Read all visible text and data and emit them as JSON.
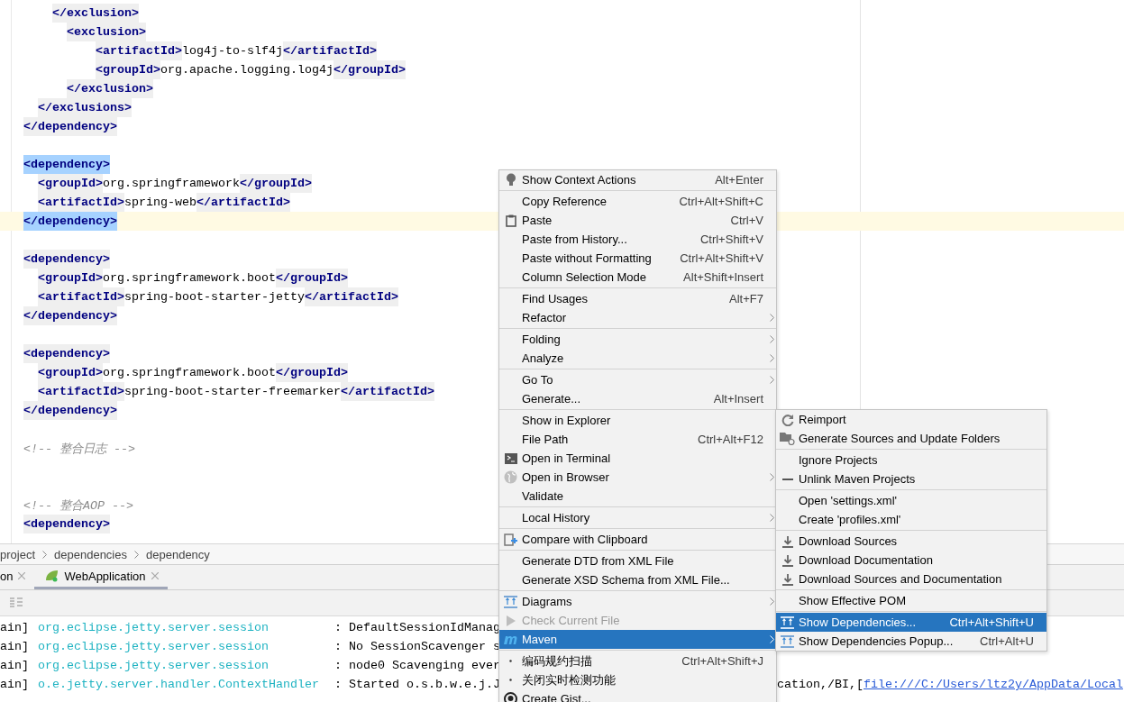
{
  "editor": {
    "lines": [
      {
        "kind": "group",
        "children": [
          {
            "kind": "group",
            "children": [
              {
                "kind": "code",
                "matched": false,
                "current": false,
                "tokens": [
                  {
                    "kind": "tag",
                    "text": "</exclusion>"
                  }
                ]
              },
              {
                "kind": "group",
                "children": [
                  {
                    "kind": "code",
                    "matched": false,
                    "current": false,
                    "tokens": [
                      {
                        "kind": "tag",
                        "text": "<exclusion>"
                      }
                    ],
                    "children": [
                      {
                        "kind": "code",
                        "matched": false,
                        "current": false,
                        "tokens": [
                          {
                            "kind": "tag",
                            "text": "<artifactId>"
                          },
                          {
                            "kind": "text",
                            "text": "log4j-to-slf4j"
                          },
                          {
                            "kind": "tag",
                            "text": "</artifactId>"
                          }
                        ]
                      },
                      {
                        "kind": "code",
                        "matched": false,
                        "current": false,
                        "tokens": [
                          {
                            "kind": "tag",
                            "text": "<groupId>"
                          },
                          {
                            "kind": "text",
                            "text": "org.apache.logging.log4j"
                          },
                          {
                            "kind": "tag",
                            "text": "</groupId>"
                          }
                        ]
                      }
                    ]
                  },
                  {
                    "kind": "code",
                    "matched": false,
                    "current": false,
                    "tokens": [
                      {
                        "kind": "tag",
                        "text": "</exclusion>"
                      }
                    ]
                  }
                ]
              }
            ]
          },
          {
            "kind": "code",
            "matched": false,
            "current": false,
            "tokens": [
              {
                "kind": "tag",
                "text": "</exclusions>"
              }
            ]
          }
        ]
      },
      {
        "kind": "code",
        "matched": false,
        "current": false,
        "tokens": [
          {
            "kind": "tag",
            "text": "</dependency>"
          }
        ]
      },
      {
        "kind": "blank"
      },
      {
        "kind": "code",
        "matched": true,
        "current": false,
        "tokens": [
          {
            "kind": "tag",
            "text": "<dependency>"
          }
        ],
        "children": [
          {
            "kind": "code",
            "matched": false,
            "current": false,
            "tokens": [
              {
                "kind": "tag",
                "text": "<groupId>"
              },
              {
                "kind": "text",
                "text": "org.springframework"
              },
              {
                "kind": "tag",
                "text": "</groupId>"
              }
            ]
          },
          {
            "kind": "code",
            "matched": false,
            "current": false,
            "tokens": [
              {
                "kind": "tag",
                "text": "<artifactId>"
              },
              {
                "kind": "text",
                "text": "spring-web"
              },
              {
                "kind": "tag",
                "text": "</artifactId>"
              }
            ]
          }
        ]
      },
      {
        "kind": "code",
        "matched": true,
        "current": true,
        "tokens": [
          {
            "kind": "tag",
            "text": "</dependency>"
          }
        ]
      },
      {
        "kind": "blank"
      },
      {
        "kind": "code",
        "matched": false,
        "current": false,
        "tokens": [
          {
            "kind": "tag",
            "text": "<dependency>"
          }
        ],
        "children": [
          {
            "kind": "code",
            "matched": false,
            "current": false,
            "tokens": [
              {
                "kind": "tag",
                "text": "<groupId>"
              },
              {
                "kind": "text",
                "text": "org.springframework.boot"
              },
              {
                "kind": "tag",
                "text": "</groupId>"
              }
            ]
          },
          {
            "kind": "code",
            "matched": false,
            "current": false,
            "tokens": [
              {
                "kind": "tag",
                "text": "<artifactId>"
              },
              {
                "kind": "text",
                "text": "spring-boot-starter-jetty"
              },
              {
                "kind": "tag",
                "text": "</artifactId>"
              }
            ]
          }
        ]
      },
      {
        "kind": "code",
        "matched": false,
        "current": false,
        "tokens": [
          {
            "kind": "tag",
            "text": "</dependency>"
          }
        ]
      },
      {
        "kind": "blank"
      },
      {
        "kind": "code",
        "matched": false,
        "current": false,
        "tokens": [
          {
            "kind": "tag",
            "text": "<dependency>"
          }
        ],
        "children": [
          {
            "kind": "code",
            "matched": false,
            "current": false,
            "tokens": [
              {
                "kind": "tag",
                "text": "<groupId>"
              },
              {
                "kind": "text",
                "text": "org.springframework.boot"
              },
              {
                "kind": "tag",
                "text": "</groupId>"
              }
            ]
          },
          {
            "kind": "code",
            "matched": false,
            "current": false,
            "tokens": [
              {
                "kind": "tag",
                "text": "<artifactId>"
              },
              {
                "kind": "text",
                "text": "spring-boot-starter-freemarker"
              },
              {
                "kind": "tag",
                "text": "</artifactId>"
              }
            ]
          }
        ]
      },
      {
        "kind": "code",
        "matched": false,
        "current": false,
        "tokens": [
          {
            "kind": "tag",
            "text": "</dependency>"
          }
        ]
      },
      {
        "kind": "blank"
      },
      {
        "kind": "code",
        "current": false,
        "tokens": [
          {
            "kind": "comment",
            "text": "<!-- 整合日志 -->"
          }
        ]
      },
      {
        "kind": "blank"
      },
      {
        "kind": "blank"
      },
      {
        "kind": "code",
        "current": false,
        "tokens": [
          {
            "kind": "comment",
            "text": "<!-- 整合AOP -->"
          }
        ]
      },
      {
        "kind": "code",
        "matched": false,
        "current": false,
        "tokens": [
          {
            "kind": "tag",
            "text": "<dependency>"
          }
        ]
      }
    ]
  },
  "breadcrumbs": [
    "project",
    "dependencies",
    "dependency"
  ],
  "run_panel": {
    "tabs": [
      {
        "label": "on",
        "selected": false
      },
      {
        "label": "WebApplication",
        "selected": true
      }
    ],
    "console": [
      {
        "thread": "ain]",
        "logger": "org.eclipse.jetty.server.session",
        "message": ": DefaultSessionIdManag"
      },
      {
        "thread": "ain]",
        "logger": "org.eclipse.jetty.server.session",
        "message": ": No SessionScavenger s"
      },
      {
        "thread": "ain]",
        "logger": "org.eclipse.jetty.server.session",
        "message": ": node0 Scavenging ever"
      },
      {
        "thread": "ain]",
        "logger": "o.e.jetty.server.handler.ContextHandler",
        "message": ": Started o.s.b.w.e.j.J",
        "tail": "cation,/BI,[",
        "link": "file:///C:/Users/ltz2y/AppData/Local"
      }
    ]
  },
  "context_menu": {
    "groups": [
      [
        {
          "kind": "bulb",
          "label": "Show Context Actions",
          "shortcut": "Alt+Enter",
          "submenu": false,
          "disabled": false,
          "selected": false
        }
      ],
      [
        {
          "kind": "plain",
          "label": "Copy Reference",
          "shortcut": "Ctrl+Alt+Shift+C",
          "submenu": false,
          "disabled": false,
          "selected": false
        },
        {
          "kind": "clipboard",
          "label": "Paste",
          "shortcut": "Ctrl+V",
          "submenu": false,
          "disabled": false,
          "selected": false
        },
        {
          "kind": "plain",
          "label": "Paste from History...",
          "shortcut": "Ctrl+Shift+V",
          "submenu": false,
          "disabled": false,
          "selected": false
        },
        {
          "kind": "plain",
          "label": "Paste without Formatting",
          "shortcut": "Ctrl+Alt+Shift+V",
          "submenu": false,
          "disabled": false,
          "selected": false
        },
        {
          "kind": "plain",
          "label": "Column Selection Mode",
          "shortcut": "Alt+Shift+Insert",
          "submenu": false,
          "disabled": false,
          "selected": false
        }
      ],
      [
        {
          "kind": "plain",
          "label": "Find Usages",
          "shortcut": "Alt+F7",
          "submenu": false,
          "disabled": false,
          "selected": false
        },
        {
          "kind": "plain",
          "label": "Refactor",
          "submenu": true,
          "disabled": false,
          "selected": false
        }
      ],
      [
        {
          "kind": "plain",
          "label": "Folding",
          "submenu": true,
          "disabled": false,
          "selected": false
        },
        {
          "kind": "plain",
          "label": "Analyze",
          "submenu": true,
          "disabled": false,
          "selected": false
        }
      ],
      [
        {
          "kind": "plain",
          "label": "Go To",
          "submenu": true,
          "disabled": false,
          "selected": false
        },
        {
          "kind": "plain",
          "label": "Generate...",
          "shortcut": "Alt+Insert",
          "submenu": false,
          "disabled": false,
          "selected": false
        }
      ],
      [
        {
          "kind": "plain",
          "label": "Show in Explorer",
          "submenu": false,
          "disabled": false,
          "selected": false
        },
        {
          "kind": "plain",
          "label": "File Path",
          "shortcut": "Ctrl+Alt+F12",
          "submenu": false,
          "disabled": false,
          "selected": false
        },
        {
          "kind": "terminal",
          "label": "Open in Terminal",
          "submenu": false,
          "disabled": false,
          "selected": false
        },
        {
          "kind": "globe",
          "label": "Open in Browser",
          "submenu": true,
          "disabled": false,
          "selected": false
        },
        {
          "kind": "plain",
          "label": "Validate",
          "submenu": false,
          "disabled": false,
          "selected": false
        }
      ],
      [
        {
          "kind": "plain",
          "label": "Local History",
          "submenu": true,
          "disabled": false,
          "selected": false
        }
      ],
      [
        {
          "kind": "compare",
          "label": "Compare with Clipboard",
          "submenu": false,
          "disabled": false,
          "selected": false
        }
      ],
      [
        {
          "kind": "plain",
          "label": "Generate DTD from XML File",
          "submenu": false,
          "disabled": false,
          "selected": false
        },
        {
          "kind": "plain",
          "label": "Generate XSD Schema from XML File...",
          "submenu": false,
          "disabled": false,
          "selected": false
        }
      ],
      [
        {
          "kind": "diagram",
          "label": "Diagrams",
          "submenu": true,
          "disabled": false,
          "selected": false
        },
        {
          "kind": "play",
          "label": "Check Current File",
          "submenu": false,
          "disabled": true,
          "selected": false
        },
        {
          "kind": "maven",
          "label": "Maven",
          "submenu": true,
          "disabled": false,
          "selected": true
        }
      ],
      [
        {
          "kind": "dot",
          "label": "编码规约扫描",
          "shortcut": "Ctrl+Alt+Shift+J",
          "submenu": false,
          "disabled": false,
          "selected": false
        },
        {
          "kind": "dot",
          "label": "关闭实时检测功能",
          "submenu": false,
          "disabled": false,
          "selected": false
        },
        {
          "kind": "github",
          "label": "Create Gist...",
          "submenu": false,
          "disabled": false,
          "selected": false
        }
      ]
    ]
  },
  "maven_submenu": {
    "groups": [
      [
        {
          "kind": "reload",
          "label": "Reimport",
          "submenu": false,
          "disabled": false,
          "selected": false
        },
        {
          "kind": "folder",
          "label": "Generate Sources and Update Folders",
          "submenu": false,
          "disabled": false,
          "selected": false
        }
      ],
      [
        {
          "kind": "plain",
          "label": "Ignore Projects",
          "submenu": false,
          "disabled": false,
          "selected": false
        },
        {
          "kind": "minus",
          "label": "Unlink Maven Projects",
          "submenu": false,
          "disabled": false,
          "selected": false
        }
      ],
      [
        {
          "kind": "plain",
          "label": "Open 'settings.xml'",
          "submenu": false,
          "disabled": false,
          "selected": false
        },
        {
          "kind": "plain",
          "label": "Create 'profiles.xml'",
          "submenu": false,
          "disabled": false,
          "selected": false
        }
      ],
      [
        {
          "kind": "download",
          "label": "Download Sources",
          "submenu": false,
          "disabled": false,
          "selected": false
        },
        {
          "kind": "download",
          "label": "Download Documentation",
          "submenu": false,
          "disabled": false,
          "selected": false
        },
        {
          "kind": "download",
          "label": "Download Sources and Documentation",
          "submenu": false,
          "disabled": false,
          "selected": false
        }
      ],
      [
        {
          "kind": "plain",
          "label": "Show Effective POM",
          "submenu": false,
          "disabled": false,
          "selected": false
        }
      ],
      [
        {
          "kind": "diagram",
          "label": "Show Dependencies...",
          "shortcut": "Ctrl+Alt+Shift+U",
          "submenu": false,
          "disabled": false,
          "selected": true
        },
        {
          "kind": "diagram",
          "label": "Show Dependencies Popup...",
          "shortcut": "Ctrl+Alt+U",
          "submenu": false,
          "disabled": false,
          "selected": false
        }
      ]
    ]
  }
}
